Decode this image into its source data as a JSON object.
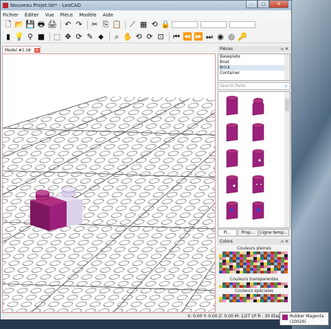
{
  "window": {
    "title": "Nouveau Projet.ldr* - LeoCAD",
    "controls": {
      "minimize": "–",
      "maximize": "▢",
      "close": "✕"
    }
  },
  "menu": [
    "Fichier",
    "Éditer",
    "Vue",
    "Pièce",
    "Modèle",
    "Aide"
  ],
  "toolbar1": {
    "icons": [
      "new-file-icon",
      "open-folder-icon",
      "save-icon",
      "print-icon",
      "print-preview-icon",
      "undo-icon",
      "redo-icon",
      "cut-icon",
      "copy-icon",
      "paste-icon",
      "snap-icon",
      "grid-icon",
      "rotate-snap-icon",
      "lock-icon"
    ],
    "glyphs": [
      "🗋",
      "📂",
      "💾",
      "🖶",
      "🖨",
      "↶",
      "↷",
      "✂",
      "⎘",
      "📋",
      "⟋",
      "▦",
      "⟲",
      "🔒"
    ]
  },
  "toolbar2": {
    "icons": [
      "insert-brick-icon",
      "light-icon",
      "spotlight-icon",
      "camera-icon",
      "select-icon",
      "move-icon",
      "rotate-icon",
      "delete-icon",
      "paint-icon",
      "zoom-icon",
      "pan-icon",
      "rotate-view-icon",
      "roll-icon",
      "zoom-region-icon",
      "first-step-icon",
      "previous-step-icon",
      "next-step-icon",
      "last-step-icon",
      "animation-icon",
      "add-keys-icon",
      "key-icon"
    ],
    "glyphs": [
      "▮",
      "💡",
      "⚲",
      "■",
      "⬚",
      "✥",
      "⟳",
      "✎",
      "⬥",
      "⌕",
      "✋",
      "⟲",
      "⟳",
      "⊡",
      "⏮",
      "⏪",
      "⏩",
      "⏭",
      "◉",
      "◎",
      "🔑"
    ]
  },
  "tab": {
    "label": "Model #1.ldr",
    "close": "✕"
  },
  "pieces_panel": {
    "title": "Pièces",
    "categories": [
      "Baseplate",
      "Boat",
      "Brick",
      "Container"
    ],
    "selected": "Brick",
    "search_placeholder": "Search Parts",
    "tabs": [
      "Pi...",
      "Prop...",
      "Ligne temp..."
    ]
  },
  "colors_panel": {
    "title": "Colors",
    "sections": [
      "Couleurs pleines",
      "Couleurs transparentes",
      "Couleurs spéciales"
    ]
  },
  "status": "X: 0.00 Y: 0.00 Z: 0.00   M: 1/2T 1P R : 30   Etape 1",
  "tooltip": {
    "name": "Rubber Magenta",
    "code": "(10026)",
    "color": "#9c1f7c"
  },
  "brick_color": "#9c1f7c",
  "selected_brick_color": "#dcd1ea"
}
